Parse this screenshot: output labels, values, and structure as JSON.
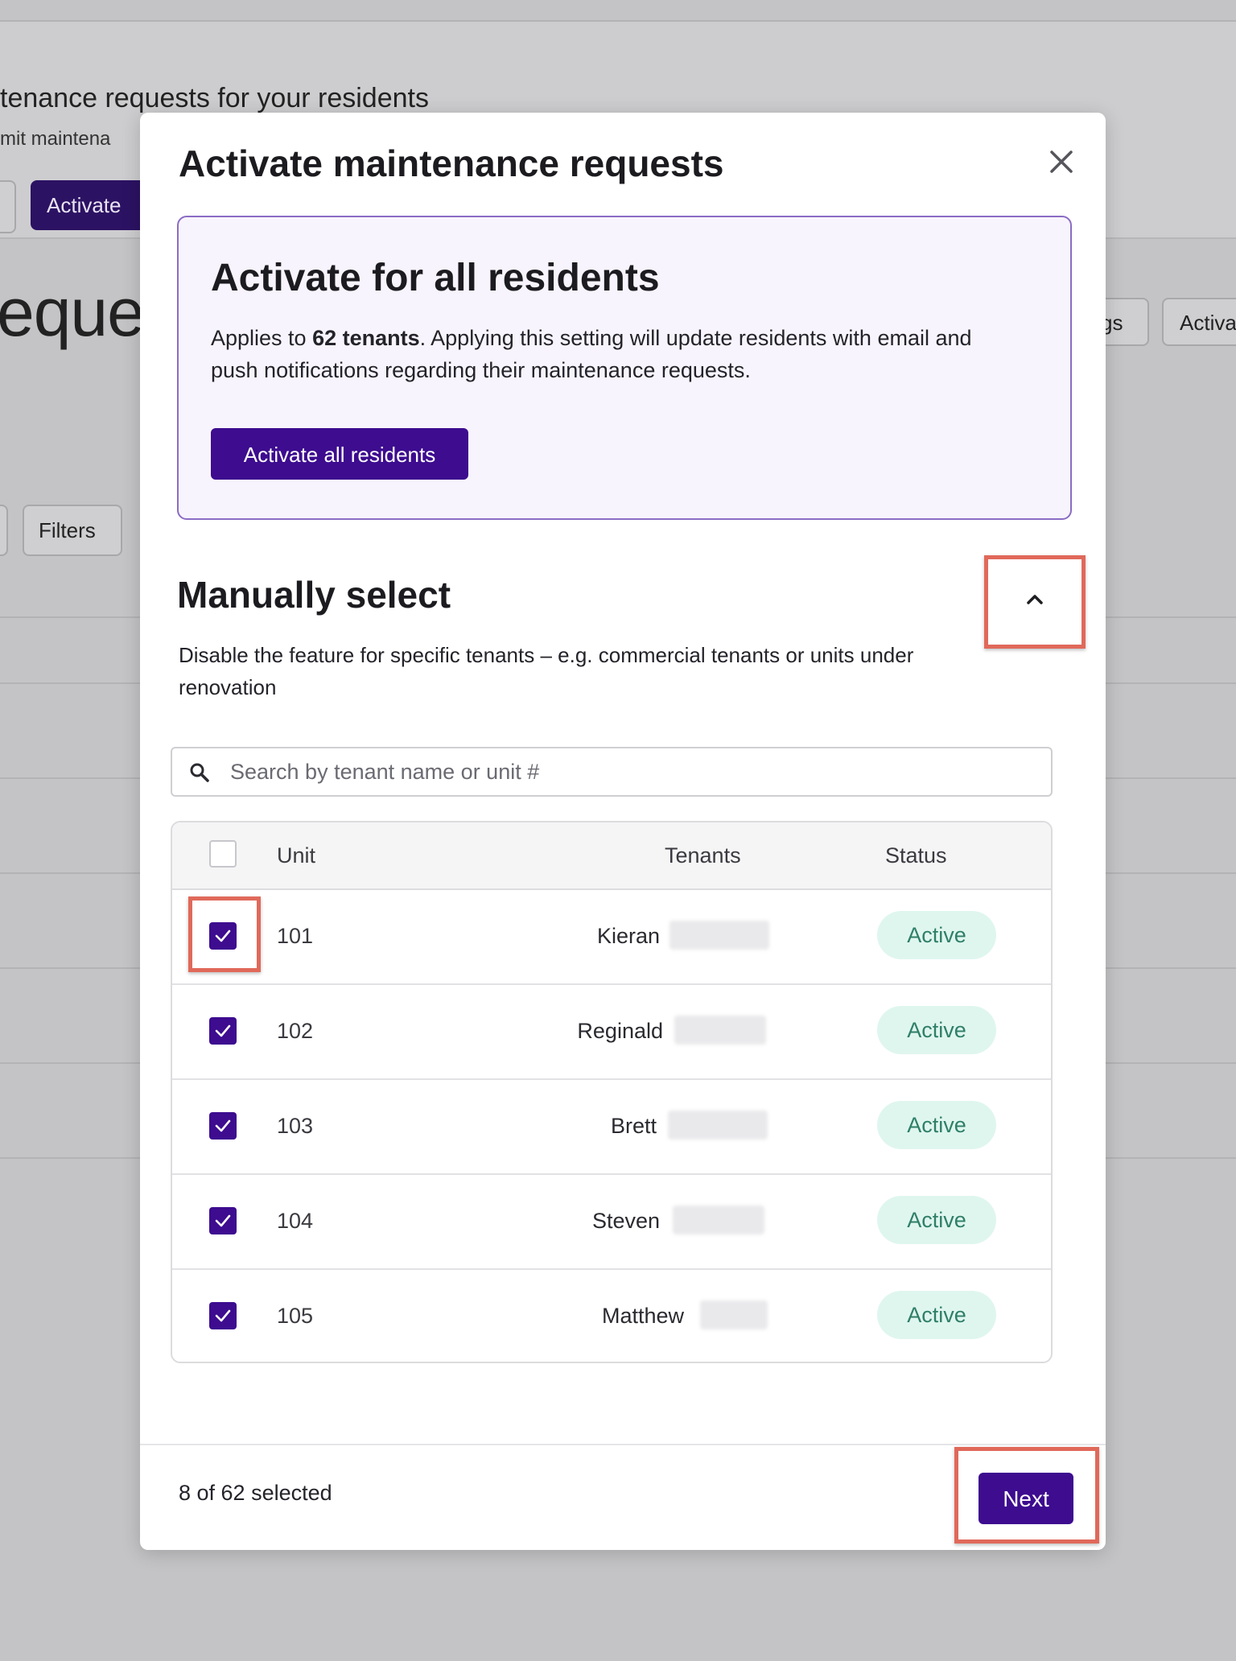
{
  "background": {
    "title": "tenance requests for your residents",
    "subtitle": "mit maintena",
    "activate_button": "Activate",
    "heading": "eque",
    "pill_settings": "gs",
    "pill_activate": "Activa",
    "filters_button": "Filters"
  },
  "modal": {
    "title": "Activate maintenance requests",
    "close_icon": "close-icon",
    "promo": {
      "title": "Activate for all residents",
      "text_prefix": "Applies to ",
      "tenant_count": "62 tenants",
      "text_suffix": ". Applying this setting will update residents with email and push notifications regarding their maintenance requests.",
      "button": "Activate all residents"
    },
    "manual": {
      "title": "Manually select",
      "description": "Disable the feature for specific tenants – e.g. commercial tenants or units under renovation",
      "collapse_icon": "chevron-up-icon"
    },
    "search": {
      "placeholder": "Search by tenant name or unit #",
      "icon": "search-icon"
    },
    "table": {
      "headers": {
        "unit": "Unit",
        "tenants": "Tenants",
        "status": "Status"
      },
      "rows": [
        {
          "unit": "101",
          "tenant": "Kieran",
          "status": "Active",
          "checked": true
        },
        {
          "unit": "102",
          "tenant": "Reginald",
          "status": "Active",
          "checked": true
        },
        {
          "unit": "103",
          "tenant": "Brett",
          "status": "Active",
          "checked": true
        },
        {
          "unit": "104",
          "tenant": "Steven",
          "status": "Active",
          "checked": true
        },
        {
          "unit": "105",
          "tenant": "Matthew",
          "status": "Active",
          "checked": true
        }
      ]
    },
    "footer": {
      "selected_text": "8 of 62 selected",
      "next_button": "Next"
    }
  },
  "colors": {
    "primary": "#3d0c8f",
    "highlight": "#e0695a",
    "status_bg": "#dff6ef",
    "status_text": "#2f7f67"
  }
}
